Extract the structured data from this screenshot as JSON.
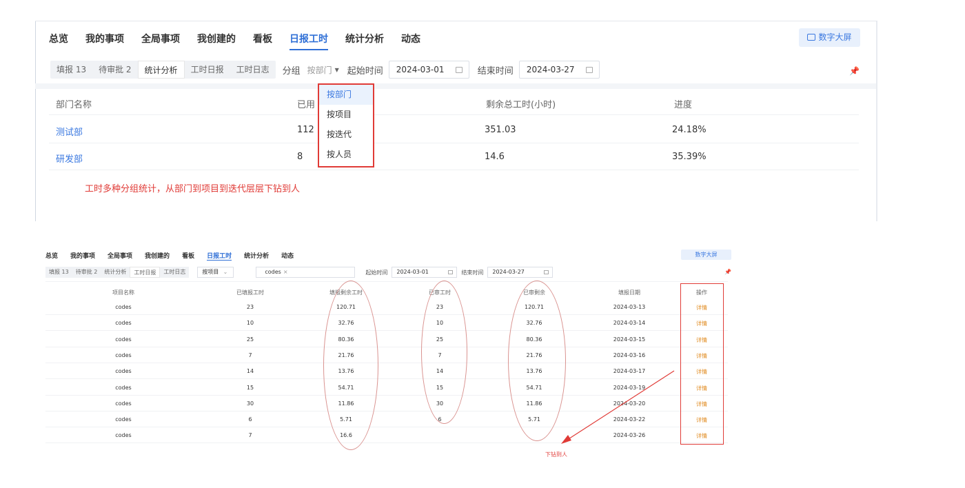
{
  "top": {
    "nav": [
      "总览",
      "我的事项",
      "全局事项",
      "我创建的",
      "看板",
      "日报工时",
      "统计分析",
      "动态"
    ],
    "nav_active": 5,
    "big_screen": "数字大屏",
    "segments": [
      "填报 13",
      "待审批 2",
      "统计分析",
      "工时日报",
      "工时日志"
    ],
    "segment_selected": 2,
    "group_label": "分组",
    "group_value": "按部门",
    "start_label": "起始时间",
    "start_date": "2024-03-01",
    "end_label": "结束时间",
    "end_date": "2024-03-27",
    "columns": {
      "dept": "部门名称",
      "used": "已用",
      "remaining": "剩余总工时(小时)",
      "progress": "进度"
    },
    "rows": [
      {
        "dept": "测试部",
        "used": "112",
        "remaining": "351.03",
        "progress": "24.18%"
      },
      {
        "dept": "研发部",
        "used": "8",
        "remaining": "14.6",
        "progress": "35.39%"
      }
    ],
    "dropdown": [
      "按部门",
      "按项目",
      "按迭代",
      "按人员"
    ],
    "dropdown_highlight": 0,
    "annotation": "工时多种分组统计，从部门到项目到迭代层层下钻到人"
  },
  "bottom": {
    "nav": [
      "总览",
      "我的事项",
      "全局事项",
      "我创建的",
      "看板",
      "日报工时",
      "统计分析",
      "动态"
    ],
    "nav_active": 5,
    "big_screen": "数字大屏",
    "segments": [
      "填报 13",
      "待审批 2",
      "统计分析",
      "工时日报",
      "工时日志"
    ],
    "segment_selected": 3,
    "group_value": "按项目",
    "filter_tag": "codes",
    "start_label": "起始时间",
    "start_date": "2024-03-01",
    "end_label": "结束时间",
    "end_date": "2024-03-27",
    "columns": [
      "项目名称",
      "已填报工时",
      "填报剩余工时",
      "已审工时",
      "已审剩余",
      "填报日期",
      "操作"
    ],
    "rows": [
      [
        "codes",
        "23",
        "120.71",
        "23",
        "120.71",
        "2024-03-13",
        "详情"
      ],
      [
        "codes",
        "10",
        "32.76",
        "10",
        "32.76",
        "2024-03-14",
        "详情"
      ],
      [
        "codes",
        "25",
        "80.36",
        "25",
        "80.36",
        "2024-03-15",
        "详情"
      ],
      [
        "codes",
        "7",
        "21.76",
        "7",
        "21.76",
        "2024-03-16",
        "详情"
      ],
      [
        "codes",
        "14",
        "13.76",
        "14",
        "13.76",
        "2024-03-17",
        "详情"
      ],
      [
        "codes",
        "15",
        "54.71",
        "15",
        "54.71",
        "2024-03-19",
        "详情"
      ],
      [
        "codes",
        "30",
        "11.86",
        "30",
        "11.86",
        "2024-03-20",
        "详情"
      ],
      [
        "codes",
        "6",
        "5.71",
        "6",
        "5.71",
        "2024-03-22",
        "详情"
      ],
      [
        "codes",
        "7",
        "16.6",
        "",
        "",
        "2024-03-26",
        "详情"
      ]
    ],
    "annotation": "下钻到人"
  },
  "colors": {
    "accent": "#2f6fd6",
    "annotation_red": "#e03a36",
    "detail_orange": "#e08a1e"
  }
}
